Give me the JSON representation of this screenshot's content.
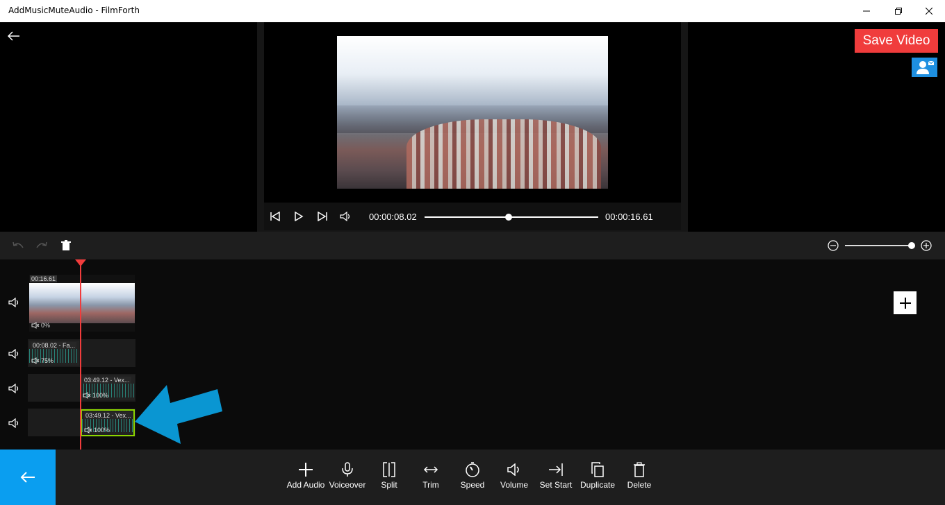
{
  "window": {
    "title": "AddMusicMuteAudio - FilmForth"
  },
  "player": {
    "current_time": "00:00:08.02",
    "total_time": "00:00:16.61",
    "progress": 0.483
  },
  "header": {
    "save_label": "Save Video"
  },
  "zoom": {
    "level": 1.0
  },
  "tracks": {
    "video": {
      "duration": "00:16.61",
      "volume": "0%"
    },
    "audio1": {
      "label": "00:08.02  - Fa...",
      "volume": "75%"
    },
    "audio2": {
      "label": "03:49.12  - Vex...",
      "volume": "100%"
    },
    "audio3": {
      "label": "03:49.12  - Vex...",
      "volume": "100%"
    }
  },
  "toolbar": {
    "items": [
      {
        "label": "Add Audio",
        "icon": "plus-icon"
      },
      {
        "label": "Voiceover",
        "icon": "microphone-icon"
      },
      {
        "label": "Split",
        "icon": "split-icon"
      },
      {
        "label": "Trim",
        "icon": "trim-icon"
      },
      {
        "label": "Speed",
        "icon": "speed-icon"
      },
      {
        "label": "Volume",
        "icon": "volume-icon"
      },
      {
        "label": "Set Start",
        "icon": "set-start-icon"
      },
      {
        "label": "Duplicate",
        "icon": "duplicate-icon"
      },
      {
        "label": "Delete",
        "icon": "trash-icon"
      }
    ]
  },
  "colors": {
    "accent": "#0a9ef0",
    "save": "#f03c3c",
    "selected": "#8cd600",
    "arrow": "#0a96d2"
  }
}
